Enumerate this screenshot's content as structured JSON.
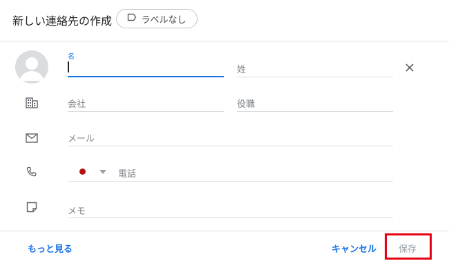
{
  "header": {
    "title": "新しい連絡先の作成",
    "label_chip": "ラベルなし"
  },
  "form": {
    "first_name": {
      "label": "名",
      "value": ""
    },
    "last_name": {
      "placeholder": "姓"
    },
    "company": {
      "placeholder": "会社"
    },
    "job_title": {
      "placeholder": "役職"
    },
    "email": {
      "placeholder": "メール"
    },
    "phone": {
      "placeholder": "電話",
      "country_color": "#b31412"
    },
    "notes": {
      "placeholder": "メモ"
    }
  },
  "footer": {
    "more": "もっと見る",
    "cancel": "キャンセル",
    "save": "保存"
  },
  "colors": {
    "accent": "#1a73e8",
    "highlight_box": "#e60012"
  }
}
